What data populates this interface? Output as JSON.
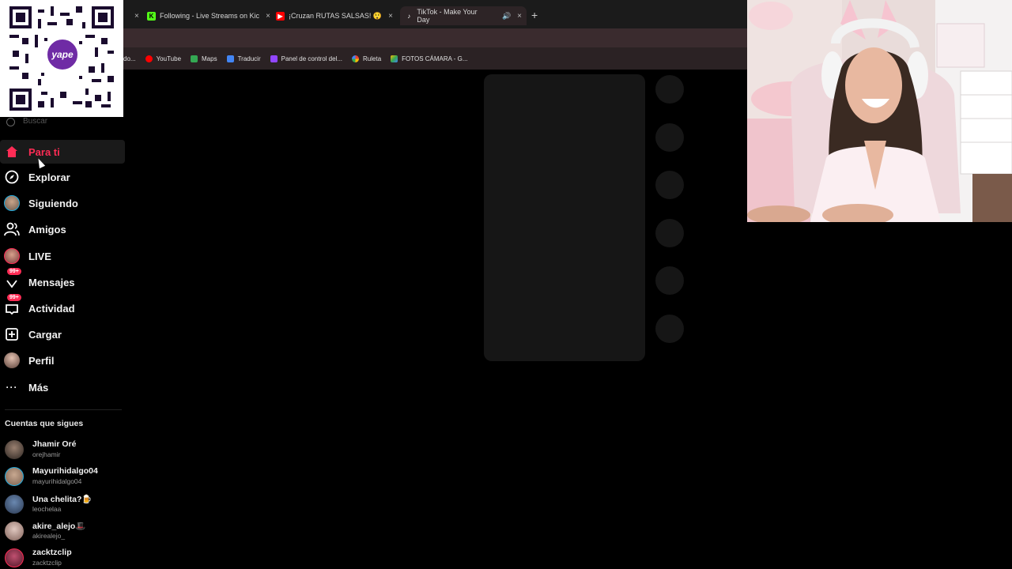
{
  "browser": {
    "tabs": [
      {
        "label": "Following - Live Streams on Kic",
        "icon": "kick-icon",
        "active": false
      },
      {
        "label": "¡Cruzan RUTAS SALSAS! 😲",
        "icon": "youtube-icon",
        "active": false
      },
      {
        "label": "TikTok - Make Your Day",
        "icon": "tiktok-icon",
        "active": true
      }
    ],
    "bookmarks": [
      {
        "label": "do...",
        "icon": "none"
      },
      {
        "label": "YouTube",
        "icon": "youtube-icon"
      },
      {
        "label": "Maps",
        "icon": "maps-icon"
      },
      {
        "label": "Traducir",
        "icon": "translate-icon"
      },
      {
        "label": "Panel de control del...",
        "icon": "twitch-icon"
      },
      {
        "label": "Ruleta",
        "icon": "roulette-icon"
      },
      {
        "label": "FOTOS CÁMARA - G...",
        "icon": "drive-icon"
      }
    ]
  },
  "qr": {
    "brand": "yape"
  },
  "sidebar": {
    "search_placeholder": "Buscar",
    "nav": [
      {
        "label": "Para ti",
        "icon": "home-icon",
        "active": true
      },
      {
        "label": "Explorar",
        "icon": "compass-icon",
        "active": false
      },
      {
        "label": "Siguiendo",
        "icon": "following-avatar-icon",
        "active": false
      },
      {
        "label": "Amigos",
        "icon": "friends-icon",
        "active": false
      },
      {
        "label": "LIVE",
        "icon": "live-avatar-icon",
        "active": false
      },
      {
        "label": "Mensajes",
        "icon": "messages-icon",
        "badge": "99+",
        "active": false
      },
      {
        "label": "Actividad",
        "icon": "activity-icon",
        "badge": "99+",
        "active": false
      },
      {
        "label": "Cargar",
        "icon": "upload-icon",
        "active": false
      },
      {
        "label": "Perfil",
        "icon": "profile-avatar-icon",
        "active": false
      },
      {
        "label": "Más",
        "icon": "more-icon",
        "active": false
      }
    ],
    "following_title": "Cuentas que sigues",
    "accounts": [
      {
        "name": "Jhamir Oré",
        "handle": "orejhamir"
      },
      {
        "name": "Mayurihidalgo04",
        "handle": "mayurihidalgo04"
      },
      {
        "name": "Una chelita?🍺",
        "handle": "leochelaa"
      },
      {
        "name": "akire_alejo🎩",
        "handle": "akirealejo_"
      },
      {
        "name": "zacktzclip",
        "handle": "zacktzclip"
      }
    ]
  },
  "colors": {
    "accent": "#fe2c55",
    "background": "#000000"
  }
}
